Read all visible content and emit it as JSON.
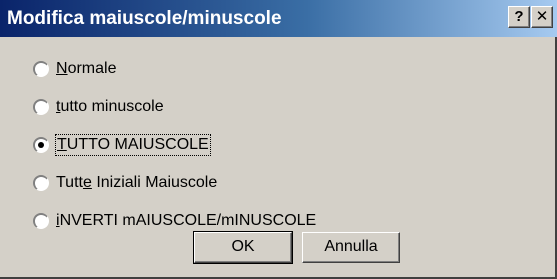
{
  "window": {
    "title": "Modifica maiuscole/minuscole",
    "help_label": "?",
    "close_label": "✕"
  },
  "options": [
    {
      "pre": "",
      "accel": "N",
      "post": "ormale",
      "checked": false
    },
    {
      "pre": "",
      "accel": "t",
      "post": "utto minuscole",
      "checked": false
    },
    {
      "pre": "",
      "accel": "T",
      "post": "UTTO MAIUSCOLE",
      "checked": true
    },
    {
      "pre": "Tutt",
      "accel": "e",
      "post": " Iniziali Maiuscole",
      "checked": false
    },
    {
      "pre": "",
      "accel": "i",
      "post": "NVERTI mAIUSCOLE/mINUSCOLE",
      "checked": false
    }
  ],
  "buttons": {
    "ok_label": "OK",
    "cancel_label": "Annulla"
  }
}
